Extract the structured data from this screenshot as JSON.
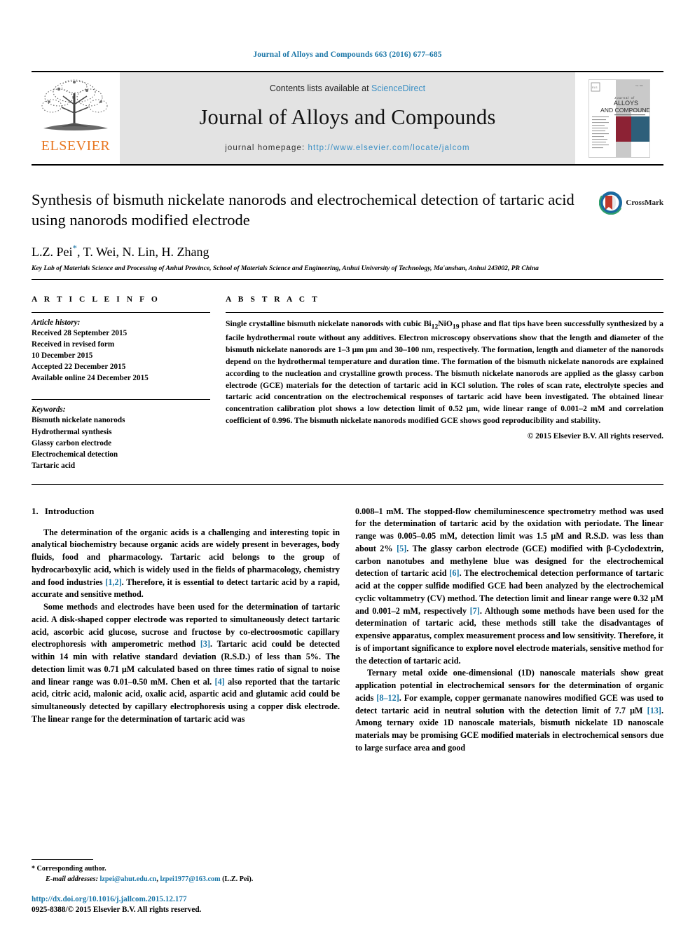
{
  "running_head": "Journal of Alloys and Compounds 663 (2016) 677–685",
  "masthead": {
    "publisher_name": "ELSEVIER",
    "contents_prefix": "Contents lists available at ",
    "contents_link": "ScienceDirect",
    "journal_name": "Journal of Alloys and Compounds",
    "homepage_prefix": "journal homepage: ",
    "homepage_url": "http://www.elsevier.com/locate/jalcom",
    "cover_title_small": "Journal of",
    "cover_title_main_1": "ALLOYS",
    "cover_title_main_2": "AND COMPOUNDS"
  },
  "article": {
    "title": "Synthesis of bismuth nickelate nanorods and electrochemical detection of tartaric acid using nanorods modified electrode",
    "authors": "L.Z. Pei, T. Wei, N. Lin, H. Zhang",
    "author_star": "*",
    "affiliation": "Key Lab of Materials Science and Processing of Anhui Province, School of Materials Science and Engineering, Anhui University of Technology, Ma'anshan, Anhui 243002, PR China",
    "crossmark_label": "CrossMark"
  },
  "article_info": {
    "heading": "A R T I C L E   I N F O",
    "history_label": "Article history:",
    "history": [
      "Received 28 September 2015",
      "Received in revised form",
      "10 December 2015",
      "Accepted 22 December 2015",
      "Available online 24 December 2015"
    ],
    "keywords_label": "Keywords:",
    "keywords": [
      "Bismuth nickelate nanorods",
      "Hydrothermal synthesis",
      "Glassy carbon electrode",
      "Electrochemical detection",
      "Tartaric acid"
    ]
  },
  "abstract": {
    "heading": "A B S T R A C T",
    "text_part1": "Single crystalline bismuth nickelate nanorods with cubic Bi",
    "formula_sub1": "12",
    "text_part2": "NiO",
    "formula_sub2": "19",
    "text_part3": " phase and flat tips have been successfully synthesized by a facile hydrothermal route without any additives. Electron microscopy observations show that the length and diameter of the bismuth nickelate nanorods are 1–3 μm μm and 30–100 nm, respectively. The formation, length and diameter of the nanorods depend on the hydrothermal temperature and duration time. The formation of the bismuth nickelate nanorods are explained according to the nucleation and crystalline growth process. The bismuth nickelate nanorods are applied as the glassy carbon electrode (GCE) materials for the detection of tartaric acid in KCl solution. The roles of scan rate, electrolyte species and tartaric acid concentration on the electrochemical responses of tartaric acid have been investigated. The obtained linear concentration calibration plot shows a low detection limit of 0.52 μm, wide linear range of 0.001–2 mM and correlation coefficient of 0.996. The bismuth nickelate nanorods modified GCE shows good reproducibility and stability.",
    "copyright": "© 2015 Elsevier B.V. All rights reserved."
  },
  "introduction": {
    "heading_number": "1.",
    "heading_text": "Introduction",
    "left_para_1_a": "The determination of the organic acids is a challenging and interesting topic in analytical biochemistry because organic acids are widely present in beverages, body fluids, food and pharmacology. Tartaric acid belongs to the group of hydrocarboxylic acid, which is widely used in the fields of pharmacology, chemistry and food industries ",
    "left_para_1_cite": "[1,2]",
    "left_para_1_b": ". Therefore, it is essential to detect tartaric acid by a rapid, accurate and sensitive method.",
    "left_para_2_a": "Some methods and electrodes have been used for the determination of tartaric acid. A disk-shaped copper electrode was reported to simultaneously detect tartaric acid, ascorbic acid glucose, sucrose and fructose by co-electroosmotic capillary electrophoresis with amperometric method ",
    "left_para_2_cite1": "[3]",
    "left_para_2_b": ". Tartaric acid could be detected within 14 min with relative standard deviation (R.S.D.) of less than 5%. The detection limit was 0.71 μM calculated based on three times ratio of signal to noise and linear range was 0.01–0.50 mM. Chen et al. ",
    "left_para_2_cite2": "[4]",
    "left_para_2_c": " also reported that the tartaric acid, citric acid, malonic acid, oxalic acid, aspartic acid and glutamic acid could be simultaneously detected by capillary electrophoresis using a copper disk electrode. The linear range for the determination of tartaric acid was",
    "right_para_1_a": "0.008–1 mM. The stopped-flow chemiluminescence spectrometry method was used for the determination of tartaric acid by the oxidation with periodate. The linear range was 0.005–0.05 mM, detection limit was 1.5 μM and R.S.D. was less than about 2% ",
    "right_para_1_cite1": "[5]",
    "right_para_1_b": ". The glassy carbon electrode (GCE) modified with β-Cyclodextrin, carbon nanotubes and methylene blue was designed for the electrochemical detection of tartaric acid ",
    "right_para_1_cite2": "[6]",
    "right_para_1_c": ". The electrochemical detection performance of tartaric acid at the copper sulfide modified GCE had been analyzed by the electrochemical cyclic voltammetry (CV) method. The detection limit and linear range were 0.32 μM and 0.001–2 mM, respectively ",
    "right_para_1_cite3": "[7]",
    "right_para_1_d": ". Although some methods have been used for the determination of tartaric acid, these methods still take the disadvantages of expensive apparatus, complex measurement process and low sensitivity. Therefore, it is of important significance to explore novel electrode materials, sensitive method for the detection of tartaric acid.",
    "right_para_2_a": "Ternary metal oxide one-dimensional (1D) nanoscale materials show great application potential in electrochemical sensors for the determination of organic acids ",
    "right_para_2_cite1": "[8–12]",
    "right_para_2_b": ". For example, copper germanate nanowires modified GCE was used to detect tartaric acid in neutral solution with the detection limit of 7.7 μM ",
    "right_para_2_cite2": "[13]",
    "right_para_2_c": ". Among ternary oxide 1D nanoscale materials, bismuth nickelate 1D nanoscale materials may be promising GCE modified materials in electrochemical sensors due to large surface area and good"
  },
  "footer": {
    "corresponding_star": "*",
    "corresponding_text": "Corresponding author.",
    "email_label": "E-mail addresses:",
    "email_1": "lzpei@ahut.edu.cn",
    "email_sep": ", ",
    "email_2": "lzpei1977@163.com",
    "email_suffix": " (L.Z. Pei).",
    "doi_url": "http://dx.doi.org/10.1016/j.jallcom.2015.12.177",
    "issn_line": "0925-8388/© 2015 Elsevier B.V. All rights reserved."
  },
  "colors": {
    "link_blue": "#1c77a8",
    "elsevier_orange": "#E87722",
    "masthead_gray": "#e3e3e3",
    "cover_maroon": "#8c2234",
    "cover_teal": "#2e5f7a"
  }
}
